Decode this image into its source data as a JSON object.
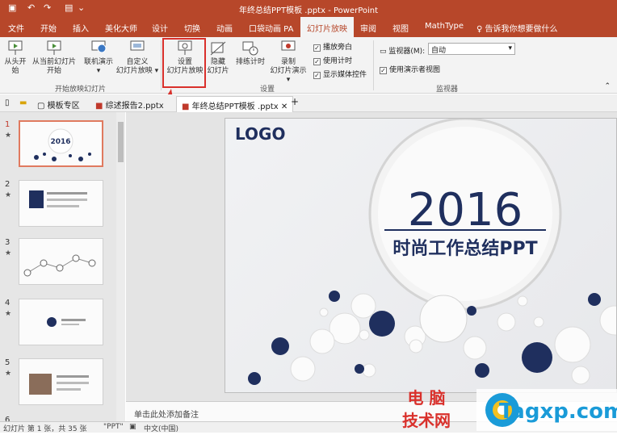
{
  "titlebar": {
    "title": "年终总结PPT模板 .pptx - PowerPoint"
  },
  "tabs": [
    "文件",
    "开始",
    "插入",
    "美化大师",
    "设计",
    "切换",
    "动画",
    "口袋动画 PA",
    "幻灯片放映",
    "审阅",
    "视图",
    "MathType"
  ],
  "active_tab": "幻灯片放映",
  "tell_me": "告诉我你想要做什么",
  "ribbon": {
    "btn_from_start": "从头开始",
    "btn_from_current_1": "从当前幻灯片",
    "btn_from_current_2": "开始",
    "btn_online_1": "联机演示",
    "btn_custom_1": "自定义",
    "btn_custom_2": "幻灯片放映",
    "group_start": "开始放映幻灯片",
    "btn_setup_1": "设置",
    "btn_setup_2": "幻灯片放映",
    "btn_hide_1": "隐藏",
    "btn_hide_2": "幻灯片",
    "btn_rehearse": "排练计时",
    "btn_record_1": "录制",
    "btn_record_2": "幻灯片演示",
    "chk_narration": "播放旁白",
    "chk_timings": "使用计时",
    "chk_media": "显示媒体控件",
    "group_setup": "设置",
    "monitor_label": "监视器(M):",
    "monitor_value": "自动",
    "chk_presenter": "使用演示者视图",
    "group_monitors": "监视器"
  },
  "doc_tabs": {
    "t1": "模板专区",
    "t2": "综述报告2.pptx",
    "t3": "年终总结PPT模板 .pptx"
  },
  "slides": [
    {
      "num": "1"
    },
    {
      "num": "2"
    },
    {
      "num": "3"
    },
    {
      "num": "4"
    },
    {
      "num": "5"
    }
  ],
  "slide": {
    "logo": "LOGO",
    "year": "2016",
    "subtitle": "时尚工作总结PPT"
  },
  "thumb_title": "2016",
  "notes_placeholder": "单击此处添加备注",
  "status": {
    "slide_info": "幻灯片 第 1 张，共 35 张",
    "theme": "\"PPT\"",
    "lang": "中文(中国)"
  },
  "watermark": {
    "line1": "电 脑",
    "line2": "技术网",
    "site": "Tagxp.com"
  },
  "colors": {
    "accent": "#b7472a",
    "navy": "#1f2f5e",
    "highlight": "#d9302b"
  }
}
